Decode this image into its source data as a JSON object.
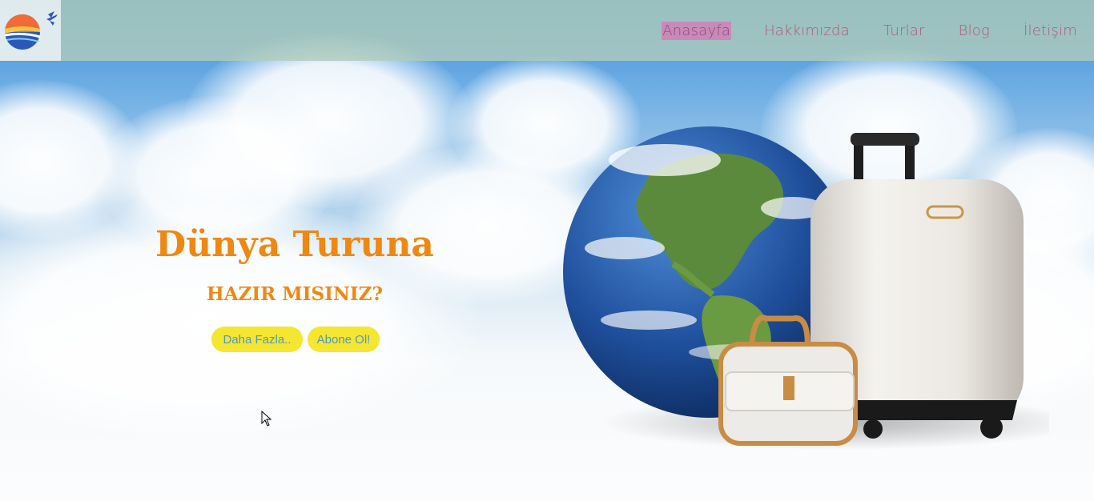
{
  "navbar": {
    "logo_icon": "globe-airplane-logo",
    "links": [
      {
        "label": "Anasayfa",
        "active": true
      },
      {
        "label": "Hakkımızda",
        "active": false
      },
      {
        "label": "Turlar",
        "active": false
      },
      {
        "label": "Blog",
        "active": false
      },
      {
        "label": "İletişim",
        "active": false
      }
    ]
  },
  "hero": {
    "title": "Dünya Turuna",
    "subtitle": "HAZIR MISINIZ?",
    "buttons": {
      "more": "Daha Fazla..",
      "subscribe": "Abone Ol!"
    },
    "illustration": "earth-globe-with-suitcases"
  },
  "colors": {
    "accent": "#ee8812",
    "button_bg": "#f4e631",
    "button_text": "#4f99c5",
    "nav_text": "#b05a78",
    "nav_bg": "#b0ccba"
  }
}
